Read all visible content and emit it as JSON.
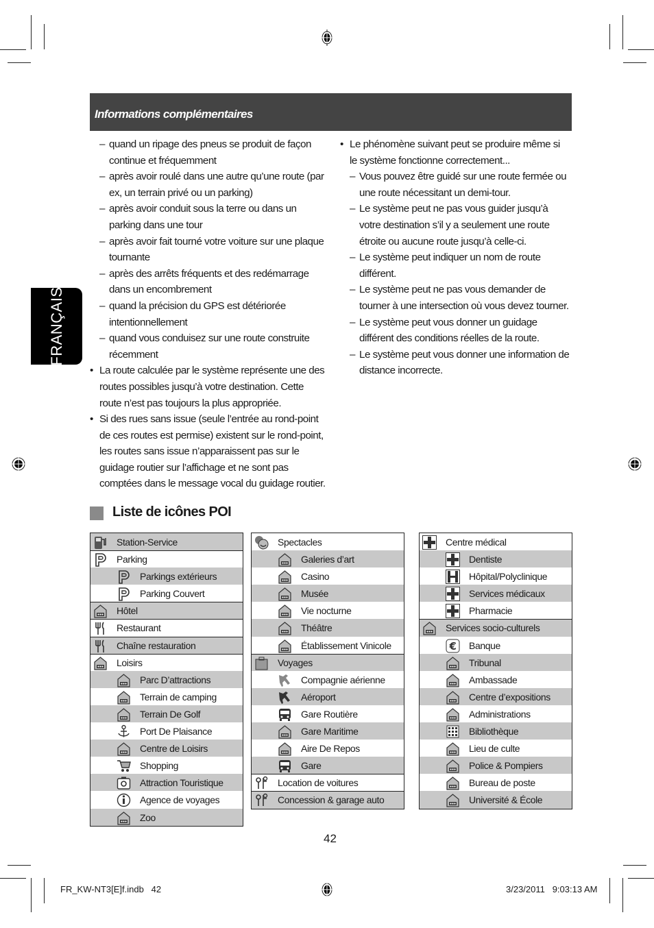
{
  "header": {
    "title": "Informations complémentaires"
  },
  "language_tab": "FRANÇAIS",
  "left_column": [
    {
      "type": "dash",
      "text": "quand un ripage des pneus se produit de façon continue et fréquemment"
    },
    {
      "type": "dash",
      "text": "après avoir roulé dans une autre qu’une route (par ex, un terrain privé ou un parking)"
    },
    {
      "type": "dash",
      "text": "après avoir conduit sous la terre ou dans un parking dans une tour"
    },
    {
      "type": "dash",
      "text": "après avoir fait tourné votre voiture sur une plaque tournante"
    },
    {
      "type": "dash",
      "text": "après des arrêts fréquents et des redémarrage dans un encombrement"
    },
    {
      "type": "dash",
      "text": "quand la précision du GPS est détériorée intentionnellement"
    },
    {
      "type": "dash",
      "text": "quand vous conduisez sur une route construite récemment"
    },
    {
      "type": "bullet",
      "text": "La route calculée par le système représente une des routes possibles jusqu’à votre destination. Cette route n’est pas toujours la plus appropriée."
    },
    {
      "type": "bullet",
      "text": "Si des rues sans issue (seule l’entrée au rond-point de ces routes est permise) existent sur le rond-point, les routes sans issue n’apparaissent pas sur le guidage routier sur l’affichage et ne sont pas comptées dans le message vocal du guidage routier."
    }
  ],
  "right_column": [
    {
      "type": "bullet",
      "text": "Le phénomène suivant peut se produire même si le système fonctionne correctement..."
    },
    {
      "type": "dash",
      "text": "Vous pouvez être guidé sur une route fermée ou une route nécessitant un demi-tour."
    },
    {
      "type": "dash",
      "text": "Le système peut ne pas vous guider jusqu’à votre destination s’il y a seulement une route étroite ou aucune route jusqu’à celle-ci."
    },
    {
      "type": "dash",
      "text": "Le système peut indiquer un nom de route différent."
    },
    {
      "type": "dash",
      "text": "Le système peut ne pas vous demander de tourner à une intersection où vous devez tourner."
    },
    {
      "type": "dash",
      "text": "Le système peut vous donner un guidage différent des conditions réelles de la route."
    },
    {
      "type": "dash",
      "text": "Le système peut vous donner une information de distance incorrecte."
    }
  ],
  "markers": {
    "dash": "–",
    "bullet": "•"
  },
  "poi_section": {
    "title": "Liste de icônes POI",
    "tables": [
      [
        {
          "label": "Station-Service",
          "level": 0,
          "grey": true,
          "icon": "fuel-pump-icon",
          "cat": true
        },
        {
          "label": "Parking",
          "level": 0,
          "grey": false,
          "icon": "parking-icon",
          "cat": true
        },
        {
          "label": "Parkings extérieurs",
          "level": 1,
          "grey": true,
          "icon": "parking-icon"
        },
        {
          "label": "Parking Couvert",
          "level": 1,
          "grey": false,
          "icon": "covered-parking-icon"
        },
        {
          "label": "Hôtel",
          "level": 0,
          "grey": true,
          "icon": "hotel-bed-icon",
          "cat": true
        },
        {
          "label": "Restaurant",
          "level": 0,
          "grey": false,
          "icon": "fork-knife-icon",
          "cat": true
        },
        {
          "label": "Chaîne restauration",
          "level": 0,
          "grey": true,
          "icon": "fork-knife-icon",
          "cat": true
        },
        {
          "label": "Loisirs",
          "level": 0,
          "grey": false,
          "icon": "ferris-wheel-icon",
          "cat": true
        },
        {
          "label": "Parc D’attractions",
          "level": 1,
          "grey": true,
          "icon": "flags-icon"
        },
        {
          "label": "Terrain de camping",
          "level": 1,
          "grey": false,
          "icon": "tree-tent-icon"
        },
        {
          "label": "Terrain De Golf",
          "level": 1,
          "grey": true,
          "icon": "golf-flag-icon"
        },
        {
          "label": "Port De Plaisance",
          "level": 1,
          "grey": false,
          "icon": "anchor-icon"
        },
        {
          "label": "Centre de Loisirs",
          "level": 1,
          "grey": true,
          "icon": "leisure-face-icon"
        },
        {
          "label": "Shopping",
          "level": 1,
          "grey": false,
          "icon": "shopping-cart-icon"
        },
        {
          "label": "Attraction Touristique",
          "level": 1,
          "grey": true,
          "icon": "camera-icon"
        },
        {
          "label": "Agence de voyages",
          "level": 1,
          "grey": false,
          "icon": "info-icon"
        },
        {
          "label": "Zoo",
          "level": 1,
          "grey": true,
          "icon": "elephant-icon"
        }
      ],
      [
        {
          "label": "Spectacles",
          "level": 0,
          "grey": false,
          "icon": "theater-masks-icon",
          "cat": true
        },
        {
          "label": "Galeries d’art",
          "level": 1,
          "grey": true,
          "icon": "gallery-building-icon"
        },
        {
          "label": "Casino",
          "level": 1,
          "grey": false,
          "icon": "casino-icon"
        },
        {
          "label": "Musée",
          "level": 1,
          "grey": true,
          "icon": "museum-icon"
        },
        {
          "label": "Vie nocturne",
          "level": 1,
          "grey": false,
          "icon": "nightlife-icon"
        },
        {
          "label": "Théâtre",
          "level": 1,
          "grey": true,
          "icon": "theater-icon"
        },
        {
          "label": "Établissement Vinicole",
          "level": 1,
          "grey": false,
          "icon": "wine-icon"
        },
        {
          "label": "Voyages",
          "level": 0,
          "grey": true,
          "icon": "suitcase-icon",
          "cat": true
        },
        {
          "label": "Compagnie aérienne",
          "level": 1,
          "grey": false,
          "icon": "airline-icon"
        },
        {
          "label": "Aéroport",
          "level": 1,
          "grey": true,
          "icon": "airplane-icon"
        },
        {
          "label": "Gare Routière",
          "level": 1,
          "grey": false,
          "icon": "bus-icon"
        },
        {
          "label": "Gare Maritime",
          "level": 1,
          "grey": true,
          "icon": "ship-icon"
        },
        {
          "label": "Aire De Repos",
          "level": 1,
          "grey": false,
          "icon": "rest-area-icon"
        },
        {
          "label": "Gare",
          "level": 1,
          "grey": true,
          "icon": "train-icon"
        },
        {
          "label": "Location de voitures",
          "level": 0,
          "grey": false,
          "icon": "car-key-icon",
          "cat": true
        },
        {
          "label": "Concession & garage auto",
          "level": 0,
          "grey": true,
          "icon": "car-key-icon",
          "cat": true
        }
      ],
      [
        {
          "label": "Centre médical",
          "level": 0,
          "grey": false,
          "icon": "medical-cross-icon",
          "cat": true
        },
        {
          "label": "Dentiste",
          "level": 1,
          "grey": true,
          "icon": "medical-cross-icon"
        },
        {
          "label": "Hôpital/Polyclinique",
          "level": 1,
          "grey": false,
          "icon": "hospital-h-icon"
        },
        {
          "label": "Services médicaux",
          "level": 1,
          "grey": true,
          "icon": "medical-cross-icon"
        },
        {
          "label": "Pharmacie",
          "level": 1,
          "grey": false,
          "icon": "medical-cross-icon"
        },
        {
          "label": "Services socio-culturels",
          "level": 0,
          "grey": true,
          "icon": "public-building-icon",
          "cat": true
        },
        {
          "label": "Banque",
          "level": 1,
          "grey": false,
          "icon": "euro-icon"
        },
        {
          "label": "Tribunal",
          "level": 1,
          "grey": true,
          "icon": "courthouse-icon"
        },
        {
          "label": "Ambassade",
          "level": 1,
          "grey": false,
          "icon": "embassy-icon"
        },
        {
          "label": "Centre d’expositions",
          "level": 1,
          "grey": true,
          "icon": "exhibition-icon"
        },
        {
          "label": "Administrations",
          "level": 1,
          "grey": false,
          "icon": "public-building-icon"
        },
        {
          "label": "Bibliothèque",
          "level": 1,
          "grey": true,
          "icon": "library-icon"
        },
        {
          "label": "Lieu de culte",
          "level": 1,
          "grey": false,
          "icon": "public-building-icon"
        },
        {
          "label": "Police & Pompiers",
          "level": 1,
          "grey": true,
          "icon": "police-station-icon"
        },
        {
          "label": "Bureau de poste",
          "level": 1,
          "grey": false,
          "icon": "post-office-icon"
        },
        {
          "label": "Université & École",
          "level": 1,
          "grey": true,
          "icon": "graduation-cap-icon"
        }
      ]
    ]
  },
  "colors": {
    "header_bg": "#444444",
    "row_grey": "#c8c8c8",
    "tab_bg": "#000000"
  },
  "page_number": "42",
  "footer": {
    "left": "FR_KW-NT3[E]f.indb   42",
    "right": "3/23/2011   9:03:13 AM"
  }
}
